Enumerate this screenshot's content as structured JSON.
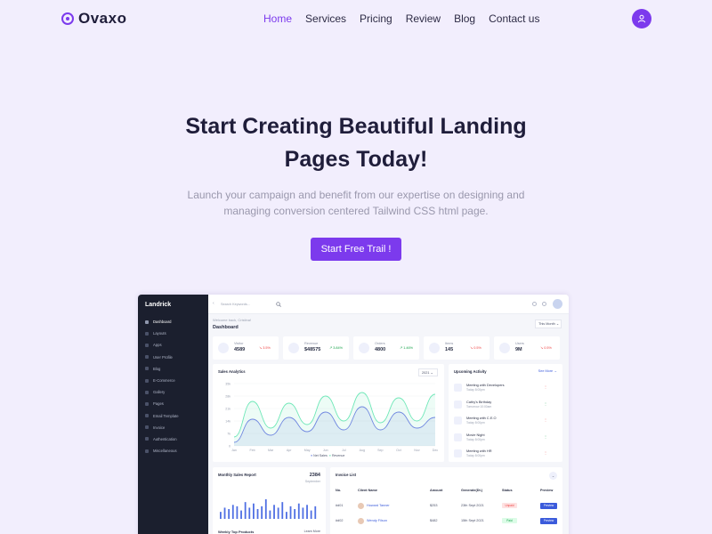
{
  "brand": {
    "name": "Ovaxo"
  },
  "nav": {
    "items": [
      "Home",
      "Services",
      "Pricing",
      "Review",
      "Blog",
      "Contact us"
    ],
    "active": "Home"
  },
  "hero": {
    "title_line1": "Start Creating Beautiful Landing",
    "title_line2": "Pages Today!",
    "subtitle_line1": "Launch your campaign and benefit from our expertise on designing and",
    "subtitle_line2": "managing conversion centered Tailwind CSS html page.",
    "cta": "Start Free Trail !"
  },
  "colors": {
    "accent": "#7c3aed",
    "page_bg": "#f2eefd",
    "sidebar": "#1b1f2e",
    "chart_primary": "#6f86e0",
    "chart_secondary": "#6ee7b7"
  },
  "dashboard": {
    "brand": "Landrick",
    "search_placeholder": "Search Keywords...",
    "sidebar": [
      "Dashboard",
      "Layouts",
      "Apps",
      "User Profile",
      "Blog",
      "E-Commerce",
      "Gallery",
      "Pages",
      "Email Template",
      "Invoice",
      "Authentication",
      "Miscellaneous"
    ],
    "welcome": "Welcome back, Cristina!",
    "title": "Dashboard",
    "period": "This Month",
    "stats": [
      {
        "label": "Visitor",
        "value": "4589",
        "change": "3.5%",
        "trend": "down"
      },
      {
        "label": "Revenue",
        "value": "$48575",
        "change": "3.84%",
        "trend": "up"
      },
      {
        "label": "Orders",
        "value": "4800",
        "change": "1.46%",
        "trend": "up"
      },
      {
        "label": "Items",
        "value": "145",
        "change": "0.5%",
        "trend": "down"
      },
      {
        "label": "Users",
        "value": "9M",
        "change": "0.5%",
        "trend": "down"
      }
    ],
    "sales": {
      "title": "Sales Analytics",
      "year": "2021",
      "legend": [
        "Net Sales",
        "Revenue"
      ]
    },
    "activity": {
      "title": "Upcoming Activity",
      "see_more": "See More",
      "items": [
        {
          "title": "Meeting with Developers",
          "sub": "Today 8:00pm"
        },
        {
          "title": "Cathy's Birthday",
          "sub": "Tomorrow 10:00am"
        },
        {
          "title": "Meeting with C.E.O",
          "sub": "Today 8:00pm"
        },
        {
          "title": "Movie Night",
          "sub": "Today 8:00pm"
        },
        {
          "title": "Meeting with HR",
          "sub": "Today 8:00pm"
        }
      ]
    },
    "monthly": {
      "title": "Monthly Sales Report",
      "value": "2384",
      "period": "September",
      "bars": [
        5,
        8,
        7,
        10,
        9,
        6,
        12,
        8,
        11,
        7,
        9,
        14,
        6,
        10,
        8,
        12,
        5,
        9,
        7,
        11,
        8,
        10,
        6,
        9
      ],
      "footer": "Weekly Top Products",
      "footer_link": "Learn More"
    },
    "invoice": {
      "title": "Invoice List",
      "headers": [
        "No.",
        "Client Name",
        "Amount",
        "Generate(Dt.)",
        "Status",
        "Preview"
      ],
      "rows": [
        {
          "no": "#d01",
          "client": "Howard Tanner",
          "amount": "$253",
          "date": "23th Sept 2021",
          "status": "Unpaid",
          "action": "Preview"
        },
        {
          "no": "#d02",
          "client": "Wendy Filson",
          "amount": "$482",
          "date": "15th Sept 2021",
          "status": "Paid",
          "action": "Preview"
        }
      ]
    }
  },
  "chart_data": {
    "type": "area",
    "x": [
      "Jan",
      "Feb",
      "Mar",
      "Apr",
      "May",
      "Jun",
      "Jul",
      "Aug",
      "Sep",
      "Oct",
      "Nov",
      "Dec"
    ],
    "series": [
      {
        "name": "Net Sales",
        "values": [
          5,
          25,
          10,
          24,
          12,
          28,
          14,
          30,
          13,
          27,
          14,
          29
        ]
      },
      {
        "name": "Revenue",
        "values": [
          2,
          15,
          6,
          16,
          8,
          19,
          9,
          22,
          9,
          19,
          10,
          16
        ]
      }
    ],
    "y_ticks": [
      "0",
      "7k",
      "14k",
      "21k",
      "28k",
      "35k"
    ],
    "ylim": [
      0,
      35
    ]
  }
}
